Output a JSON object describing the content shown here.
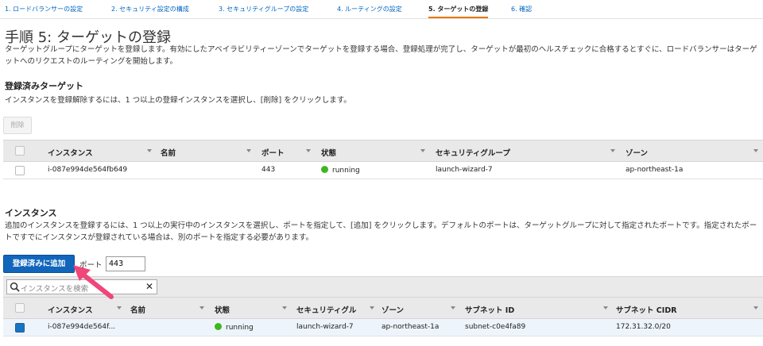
{
  "wizard": {
    "steps": [
      "1. ロードバランサーの設定",
      "2. セキュリティ設定の構成",
      "3. セキュリティグループの設定",
      "4. ルーティングの設定",
      "5. ターゲットの登録",
      "6. 確認"
    ],
    "active_index": 4
  },
  "page": {
    "title": "手順 5: ターゲットの登録",
    "description": "ターゲットグループにターゲットを登録します。有効にしたアベイラビリティーゾーンでターゲットを登録する場合、登録処理が完了し、ターゲットが最初のヘルスチェックに合格するとすぐに、ロードバランサーはターゲットへのリクエストのルーティングを開始します。"
  },
  "registered": {
    "heading": "登録済みターゲット",
    "instruction": "インスタンスを登録解除するには、1 つ以上の登録インスタンスを選択し、[削除] をクリックします。",
    "remove_label": "削除",
    "columns": [
      "インスタンス",
      "名前",
      "ポート",
      "状態",
      "セキュリティグループ",
      "ゾーン"
    ],
    "rows": [
      {
        "instance": "i-087e994de564fb649",
        "name": "",
        "port": "443",
        "state": "running",
        "security_group": "launch-wizard-7",
        "zone": "ap-northeast-1a"
      }
    ]
  },
  "instances": {
    "heading": "インスタンス",
    "instruction": "追加のインスタンスを登録するには、1 つ以上の実行中のインスタンスを選択し、ポートを指定して、[追加] をクリックします。デフォルトのポートは、ターゲットグループに対して指定されたポートです。指定されたポートですでにインスタンスが登録されている場合は、別のポートを指定する必要があります。",
    "add_label": "登録済みに追加",
    "port_label": "ポート",
    "port_value": "443",
    "search_placeholder": "インスタンスを検索",
    "columns": [
      "インスタンス",
      "名前",
      "状態",
      "セキュリティグル",
      "ゾーン",
      "サブネット ID",
      "サブネット CIDR"
    ],
    "rows": [
      {
        "instance": "i-087e994de564f...",
        "name": "",
        "state": "running",
        "security_group": "launch-wizard-7",
        "zone": "ap-northeast-1a",
        "subnet_id": "subnet-c0e4fa89",
        "subnet_cidr": "172.31.32.0/20",
        "checked": true
      }
    ]
  },
  "colors": {
    "link": "#0066c0",
    "active_tab_underline": "#e77600",
    "primary_button": "#1166bb",
    "running": "#3fb51e",
    "annotation_arrow": "#f0467a"
  },
  "icons": [
    "search-icon",
    "clear-icon",
    "sort-caret-icon",
    "running-status-icon",
    "annotation-arrow-icon"
  ]
}
